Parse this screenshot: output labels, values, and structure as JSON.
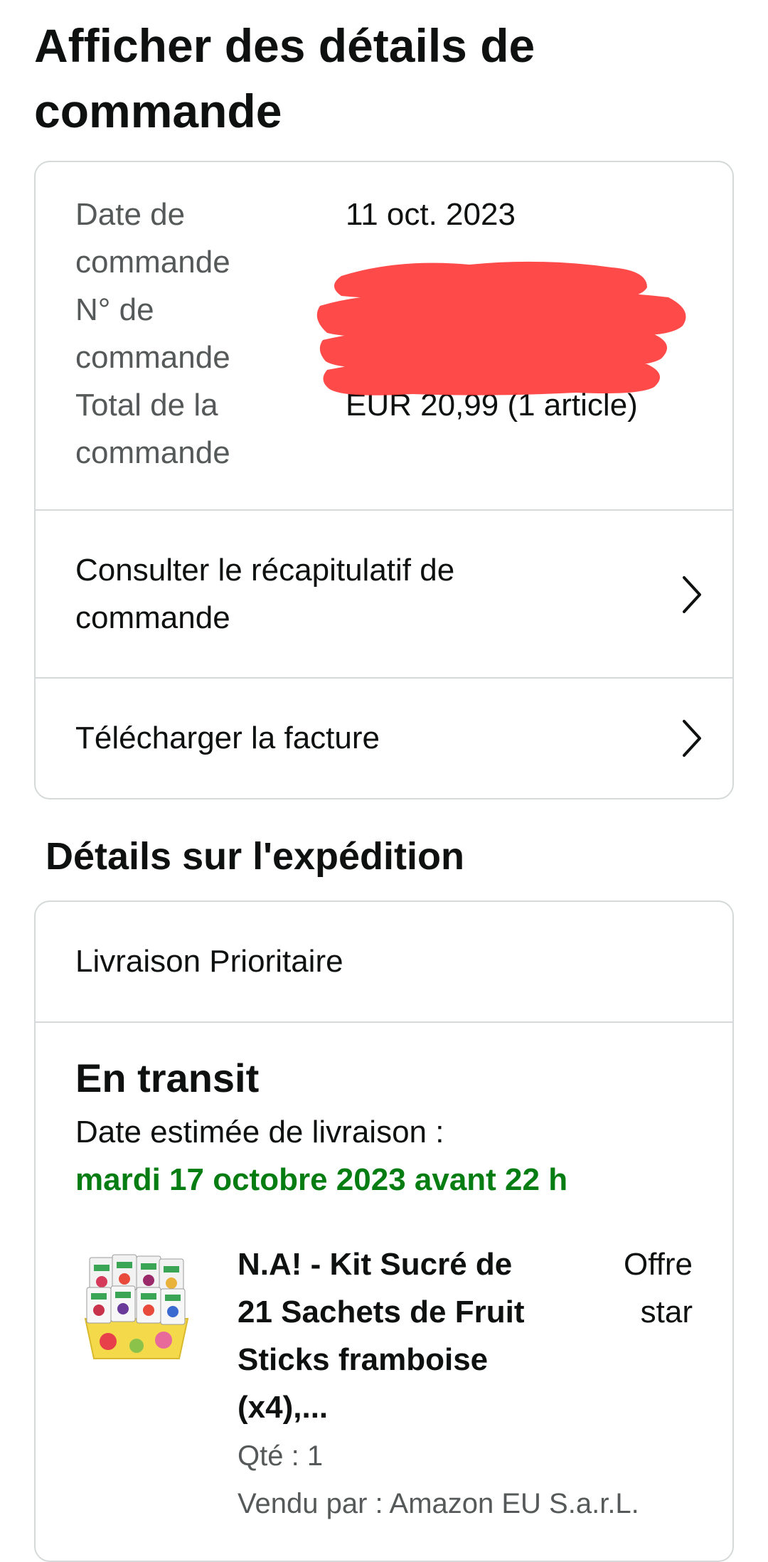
{
  "page": {
    "title": "Afficher des détails de commande"
  },
  "order_summary": {
    "date_label": "Date de commande",
    "date_label_lines": [
      "Date de",
      "commande"
    ],
    "date_value": "11 oct. 2023",
    "number_label": "N° de commande",
    "number_label_lines": [
      "N° de",
      "commande"
    ],
    "total_label": "Total de la commande",
    "total_label_lines": [
      "Total de la",
      "commande"
    ],
    "total_value": "EUR 20,99 (1 article)"
  },
  "links": {
    "summary_label": "Consulter le récapitulatif de commande",
    "invoice_label": "Télécharger la facture"
  },
  "shipment": {
    "section_title": "Détails sur l'expédition",
    "delivery_type": "Livraison Prioritaire",
    "status": "En transit",
    "eta_label": "Date estimée de livraison :",
    "eta_date": "mardi 17 octobre 2023 avant 22 h",
    "eta_color": "#067d12",
    "item": {
      "title": "N.A! - Kit Sucré de 21 Sachets de Fruit Sticks framboise (x4),...",
      "offer_badge": "Offre star",
      "quantity": "Qté : 1",
      "seller": "Vendu par : Amazon EU S.a.r.L.",
      "image_icon": "product-thumbnail"
    }
  },
  "icons": {
    "chevron": "chevron-right-icon"
  }
}
